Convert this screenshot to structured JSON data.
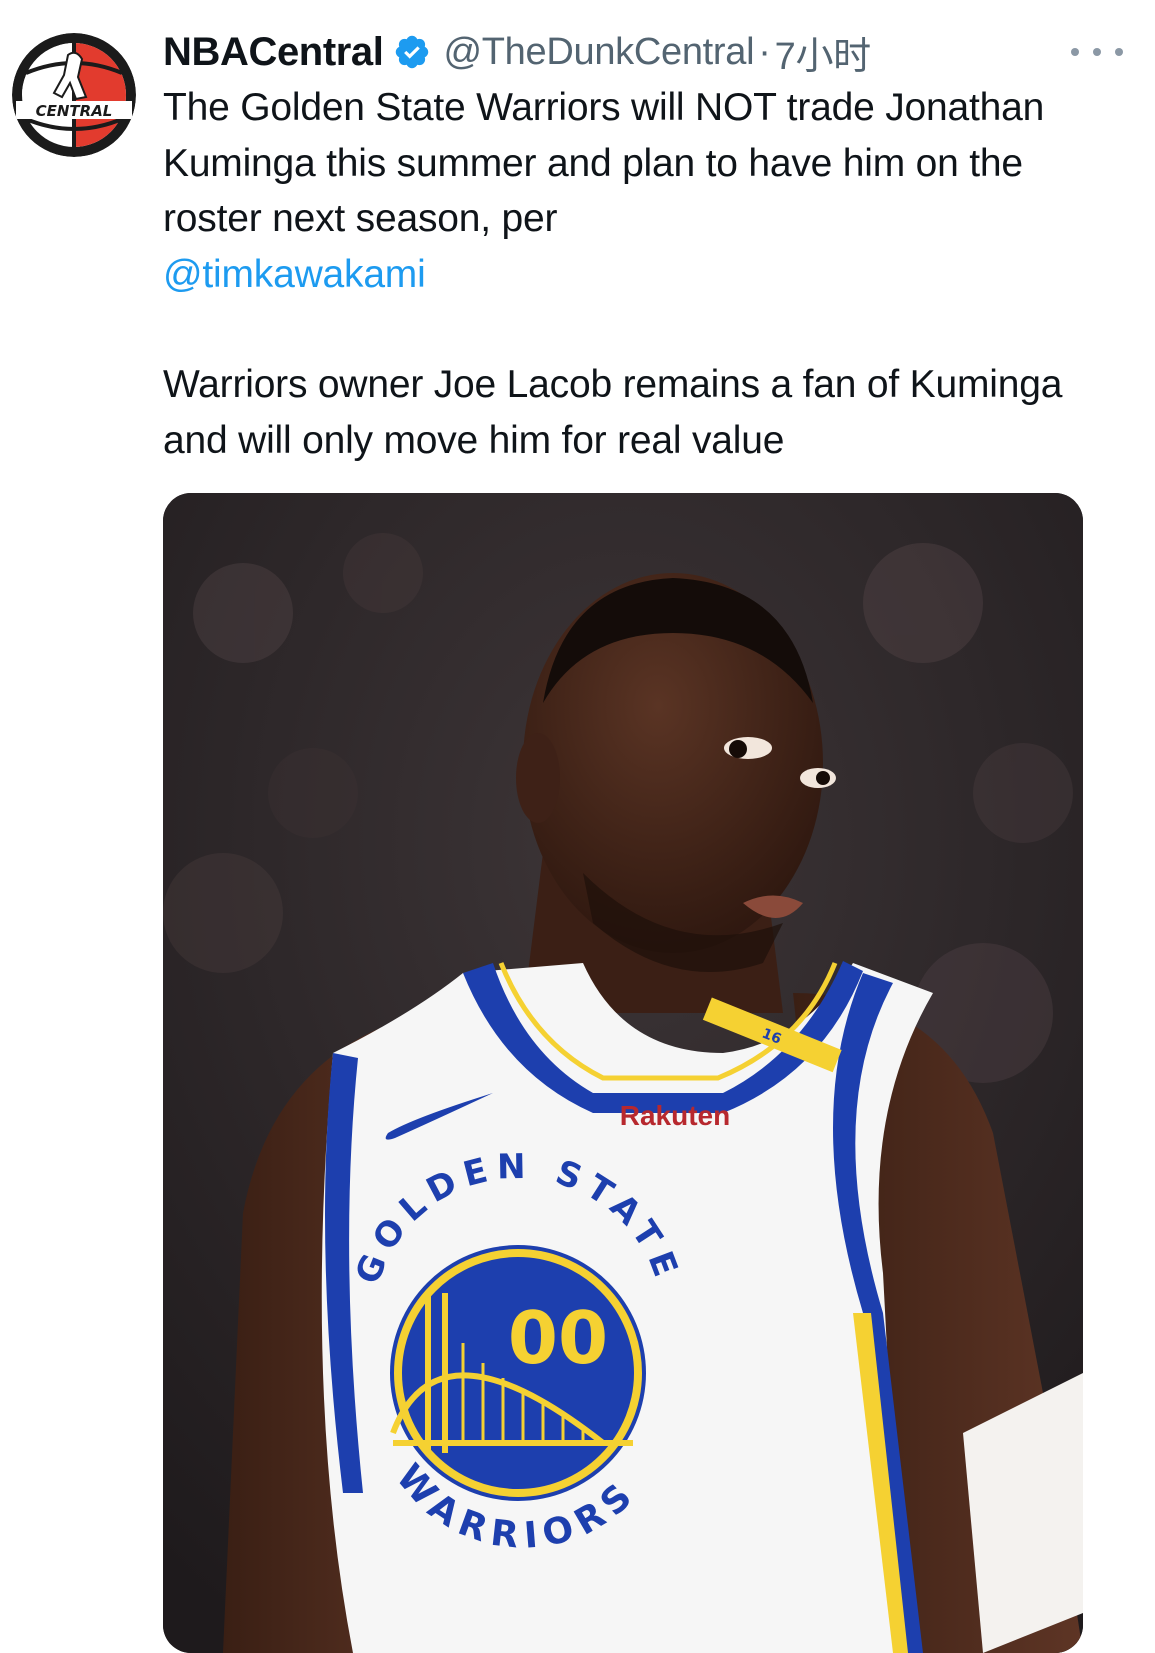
{
  "tweet": {
    "author": {
      "display_name": "NBACentral",
      "handle": "@TheDunkCentral",
      "verified": true,
      "avatar_logo_text": "CENTRAL"
    },
    "separator": "·",
    "time": "7小时",
    "text": {
      "paragraph1": "The Golden State Warriors will NOT trade Jonathan Kuminga this summer and plan to have him on the roster next season, per",
      "mention": "@timkawakami",
      "paragraph2": "Warriors owner Joe Lacob remains a fan of Kuminga and will only move him for real value"
    },
    "media": {
      "type": "photo",
      "jersey_text": {
        "sponsor": "Rakuten",
        "team_top": "GOLDEN STATE",
        "team_bottom": "WARRIORS",
        "number": "00",
        "strap_number": "16"
      }
    }
  },
  "colors": {
    "link": "#1d9bf0",
    "secondary_text": "#536471",
    "verified_badge": "#1d9bf0",
    "jersey_blue": "#1d3fae",
    "jersey_gold": "#f5d132"
  },
  "icons": {
    "verified": "verified-badge-icon",
    "more": "more-dots-icon"
  }
}
